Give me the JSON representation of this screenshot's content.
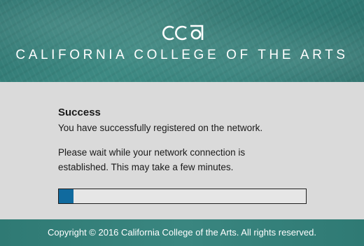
{
  "header": {
    "logo_text": "CCA",
    "college_name": "CALIFORNIA COLLEGE OF THE ARTS"
  },
  "status": {
    "title": "Success",
    "message": "You have successfully registered on the network.",
    "wait_message": "Please wait while your network connection is established. This may take a few minutes.",
    "progress_fraction": 0.06
  },
  "footer": {
    "copyright": "Copyright © 2016 California College of the Arts. All rights reserved."
  },
  "colors": {
    "brand_teal": "#2e7570",
    "progress_blue": "#106a9e"
  }
}
